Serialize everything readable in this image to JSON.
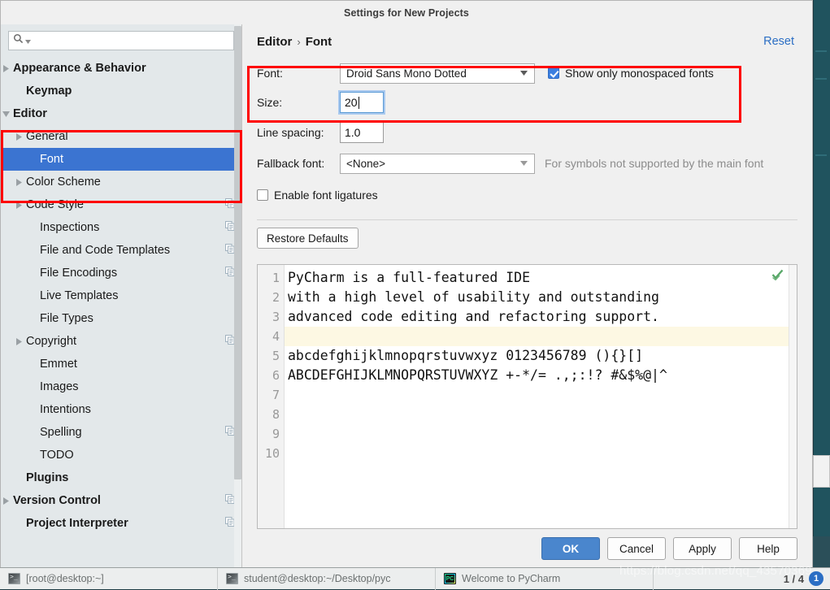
{
  "window": {
    "title": "Settings for New Projects"
  },
  "search": {
    "value": "",
    "placeholder": "",
    "icon": "search-icon"
  },
  "sidebar": {
    "items": [
      {
        "label": "Appearance & Behavior",
        "arrow": "collapsed",
        "indent": 0,
        "bold": true,
        "selected": false,
        "copy": false
      },
      {
        "label": "Keymap",
        "arrow": "none",
        "indent": 1,
        "bold": true,
        "selected": false,
        "copy": false
      },
      {
        "label": "Editor",
        "arrow": "expanded",
        "indent": 0,
        "bold": true,
        "selected": false,
        "copy": false
      },
      {
        "label": "General",
        "arrow": "collapsed",
        "indent": 1,
        "bold": false,
        "selected": false,
        "copy": false
      },
      {
        "label": "Font",
        "arrow": "none",
        "indent": 2,
        "bold": false,
        "selected": true,
        "copy": false
      },
      {
        "label": "Color Scheme",
        "arrow": "collapsed",
        "indent": 1,
        "bold": false,
        "selected": false,
        "copy": false
      },
      {
        "label": "Code Style",
        "arrow": "collapsed",
        "indent": 1,
        "bold": false,
        "selected": false,
        "copy": true
      },
      {
        "label": "Inspections",
        "arrow": "none",
        "indent": 2,
        "bold": false,
        "selected": false,
        "copy": true
      },
      {
        "label": "File and Code Templates",
        "arrow": "none",
        "indent": 2,
        "bold": false,
        "selected": false,
        "copy": true
      },
      {
        "label": "File Encodings",
        "arrow": "none",
        "indent": 2,
        "bold": false,
        "selected": false,
        "copy": true
      },
      {
        "label": "Live Templates",
        "arrow": "none",
        "indent": 2,
        "bold": false,
        "selected": false,
        "copy": false
      },
      {
        "label": "File Types",
        "arrow": "none",
        "indent": 2,
        "bold": false,
        "selected": false,
        "copy": false
      },
      {
        "label": "Copyright",
        "arrow": "collapsed",
        "indent": 1,
        "bold": false,
        "selected": false,
        "copy": true
      },
      {
        "label": "Emmet",
        "arrow": "none",
        "indent": 2,
        "bold": false,
        "selected": false,
        "copy": false
      },
      {
        "label": "Images",
        "arrow": "none",
        "indent": 2,
        "bold": false,
        "selected": false,
        "copy": false
      },
      {
        "label": "Intentions",
        "arrow": "none",
        "indent": 2,
        "bold": false,
        "selected": false,
        "copy": false
      },
      {
        "label": "Spelling",
        "arrow": "none",
        "indent": 2,
        "bold": false,
        "selected": false,
        "copy": true
      },
      {
        "label": "TODO",
        "arrow": "none",
        "indent": 2,
        "bold": false,
        "selected": false,
        "copy": false
      },
      {
        "label": "Plugins",
        "arrow": "none",
        "indent": 1,
        "bold": true,
        "selected": false,
        "copy": false
      },
      {
        "label": "Version Control",
        "arrow": "collapsed",
        "indent": 0,
        "bold": true,
        "selected": false,
        "copy": true
      },
      {
        "label": "Project Interpreter",
        "arrow": "none",
        "indent": 1,
        "bold": true,
        "selected": false,
        "copy": true
      }
    ]
  },
  "header": {
    "breadcrumb_root": "Editor",
    "breadcrumb_sep": "›",
    "breadcrumb_leaf": "Font",
    "reset_label": "Reset"
  },
  "form": {
    "font_label": "Font:",
    "font_value": "Droid Sans Mono Dotted",
    "monospaced_label": "Show only monospaced fonts",
    "monospaced_checked": true,
    "size_label": "Size:",
    "size_value": "20",
    "line_spacing_label": "Line spacing:",
    "line_spacing_value": "1.0",
    "fallback_label": "Fallback font:",
    "fallback_value": "<None>",
    "fallback_hint": "For symbols not supported by the main font",
    "ligatures_label": "Enable font ligatures",
    "ligatures_checked": false,
    "restore_defaults_label": "Restore Defaults"
  },
  "preview": {
    "line_numbers": [
      "1",
      "2",
      "3",
      "4",
      "5",
      "6",
      "7",
      "8",
      "9",
      "10"
    ],
    "lines": [
      {
        "text": "PyCharm is a full-featured IDE",
        "highlight": false
      },
      {
        "text": "with a high level of usability and outstanding",
        "highlight": false
      },
      {
        "text": "advanced code editing and refactoring support.",
        "highlight": false
      },
      {
        "text": "",
        "highlight": true
      },
      {
        "text": "abcdefghijklmnopqrstuvwxyz 0123456789 (){}[]",
        "highlight": false
      },
      {
        "text": "ABCDEFGHIJKLMNOPQRSTUVWXYZ +-*/= .,;:!? #&$%@|^",
        "highlight": false
      },
      {
        "text": "",
        "highlight": false
      },
      {
        "text": "",
        "highlight": false
      },
      {
        "text": "",
        "highlight": false
      },
      {
        "text": "",
        "highlight": false
      }
    ],
    "status_icon": "green-check-icon"
  },
  "buttons": {
    "ok": "OK",
    "cancel": "Cancel",
    "apply": "Apply",
    "help": "Help"
  },
  "taskbar": {
    "tasks": [
      {
        "label": "[root@desktop:~]",
        "icon": "terminal-icon"
      },
      {
        "label": "student@desktop:~/Desktop/pyc",
        "icon": "terminal-icon"
      },
      {
        "label": "Welcome to PyCharm",
        "icon": "pycharm-icon"
      }
    ],
    "pager_label": "1 / 4",
    "pager_badge": "1"
  },
  "watermark": {
    "text": "https://blog.csdn.net/qq_43570369"
  },
  "colors": {
    "selection": "#3b74d1",
    "annotation": "#ff0000",
    "link": "#2b6ec4",
    "primary_button": "#4a86cd",
    "caret_line": "#fdf8e3"
  }
}
